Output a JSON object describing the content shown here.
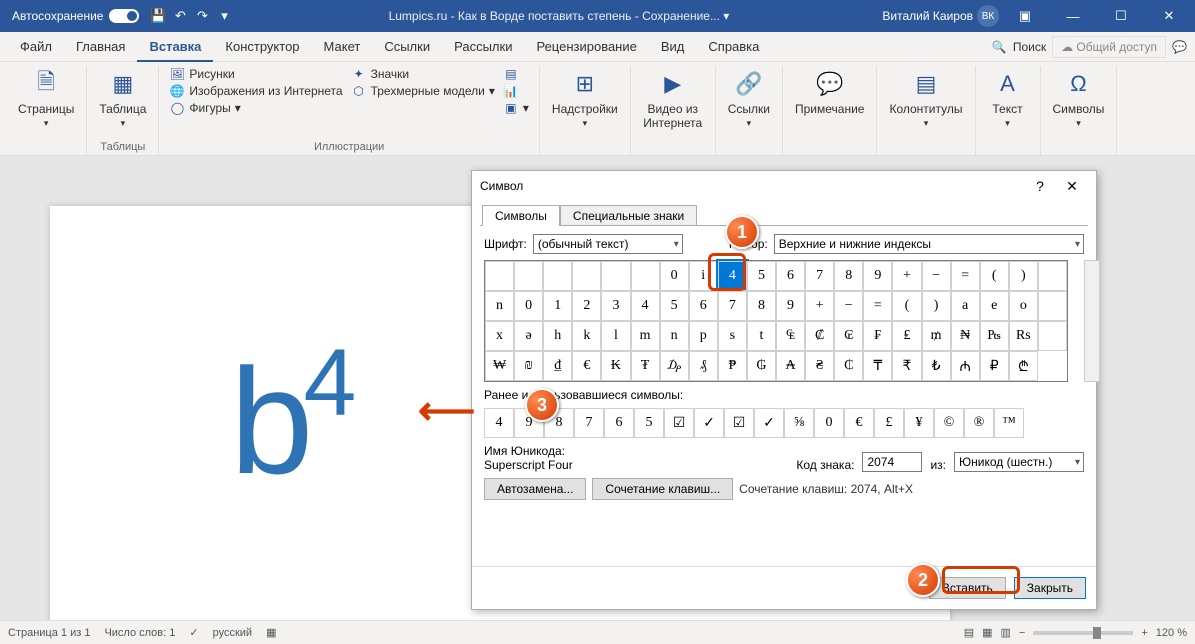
{
  "titlebar": {
    "autosave": "Автосохранение",
    "doc_title": "Lumpics.ru - Как в Ворде поставить степень - Сохранение... ▾",
    "user_name": "Виталий Каиров",
    "user_initials": "ВК"
  },
  "tabs": {
    "file": "Файл",
    "home": "Главная",
    "insert": "Вставка",
    "design": "Конструктор",
    "layout": "Макет",
    "references": "Ссылки",
    "mailings": "Рассылки",
    "review": "Рецензирование",
    "view": "Вид",
    "help": "Справка",
    "search": "Поиск",
    "share": "Общий доступ"
  },
  "ribbon": {
    "pages": "Страницы",
    "table": "Таблица",
    "tables": "Таблицы",
    "pictures": "Рисунки",
    "online_pics": "Изображения из Интернета",
    "shapes": "Фигуры",
    "icons": "Значки",
    "models": "Трехмерные модели",
    "illustrations": "Иллюстрации",
    "addins": "Надстройки",
    "video": "Видео из Интернета",
    "links": "Ссылки",
    "comment": "Примечание",
    "header_footer": "Колонтитулы",
    "text": "Текст",
    "symbols": "Символы"
  },
  "document": {
    "text": "b",
    "sup": "4"
  },
  "dialog": {
    "title": "Символ",
    "tab_symbols": "Символы",
    "tab_special": "Специальные знаки",
    "font_label": "Шрифт:",
    "font_value": "(обычный текст)",
    "set_label": "Набор:",
    "set_value": "Верхние и нижние индексы",
    "grid": [
      [
        "",
        "",
        "",
        "",
        "",
        "",
        "0",
        "i",
        "4",
        "5",
        "6",
        "7",
        "8",
        "9",
        "+",
        "−",
        "=",
        "(",
        ")"
      ],
      [
        "",
        "n",
        "0",
        "1",
        "2",
        "3",
        "4",
        "5",
        "6",
        "7",
        "8",
        "9",
        "+",
        "−",
        "=",
        "(",
        ")",
        "a",
        "e",
        "o"
      ],
      [
        "",
        "x",
        "ə",
        "h",
        "k",
        "l",
        "m",
        "n",
        "p",
        "s",
        "t",
        "₠",
        "₡",
        "₢",
        "₣",
        "₤",
        "₥",
        "₦",
        "₧",
        "Rs"
      ],
      [
        "",
        "₩",
        "₪",
        "₫",
        "€",
        "₭",
        "₮",
        "₯",
        "₰",
        "₱",
        "₲",
        "₳",
        "₴",
        "₵",
        "₸",
        "₹",
        "₺",
        "₼",
        "₽",
        "₾"
      ]
    ],
    "selected_char": "4",
    "recent_label": "Ранее использовавшиеся символы:",
    "recent": [
      "4",
      "9",
      "8",
      "7",
      "6",
      "5",
      "☑",
      "✓",
      "☑",
      "✓",
      "⅝",
      "0",
      "€",
      "£",
      "¥",
      "©",
      "®",
      "™"
    ],
    "name_label": "Имя Юникода:",
    "name_value": "Superscript Four",
    "code_label": "Код знака:",
    "code_value": "2074",
    "from_label": "из:",
    "from_value": "Юникод (шестн.)",
    "autocorrect": "Автозамена...",
    "shortcut_btn": "Сочетание клавиш...",
    "shortcut_text": "Сочетание клавиш: 2074, Alt+X",
    "insert": "Вставить",
    "close": "Закрыть"
  },
  "statusbar": {
    "page": "Страница 1 из 1",
    "words": "Число слов: 1",
    "lang": "русский",
    "zoom": "120 %"
  }
}
